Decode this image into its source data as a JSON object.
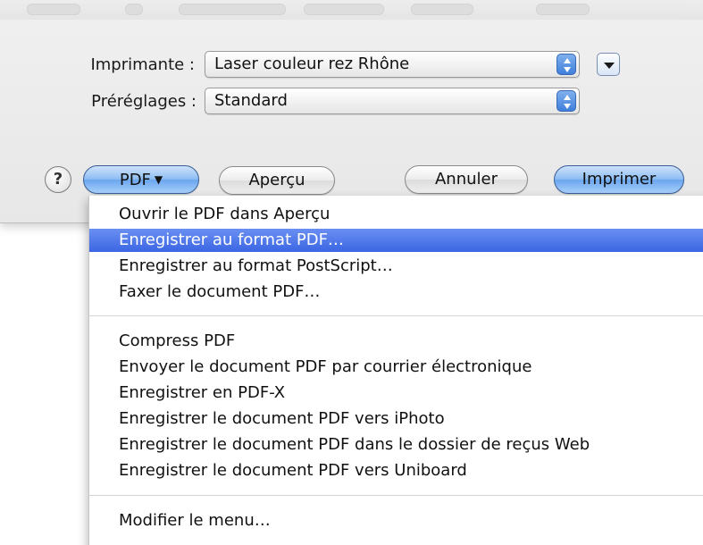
{
  "dialog": {
    "printer_label": "Imprimante :",
    "printer_value": "Laser couleur rez Rhône",
    "presets_label": "Préréglages :",
    "presets_value": "Standard"
  },
  "buttons": {
    "help": "?",
    "pdf": "PDF",
    "pdf_arrow": "▼",
    "preview": "Aperçu",
    "cancel": "Annuler",
    "print": "Imprimer"
  },
  "menu": {
    "items": [
      "Ouvrir le PDF dans Aperçu",
      "Enregistrer au format PDF…",
      "Enregistrer au format PostScript…",
      "Faxer le document PDF…",
      "Compress PDF",
      "Envoyer le document PDF par courrier électronique",
      "Enregistrer en PDF-X",
      "Enregistrer le document PDF vers iPhoto",
      "Enregistrer le document PDF dans le dossier de reçus Web",
      "Enregistrer le document PDF vers Uniboard",
      "Modifier le menu…"
    ],
    "selected_item": "Enregistrer au format PDF…"
  },
  "colors": {
    "selection": "#3b66e3",
    "default_button": "#6aa6ee"
  },
  "icons": {
    "popup_stepper": "up-down-arrows-icon",
    "disclosure": "triangle-down-icon"
  }
}
